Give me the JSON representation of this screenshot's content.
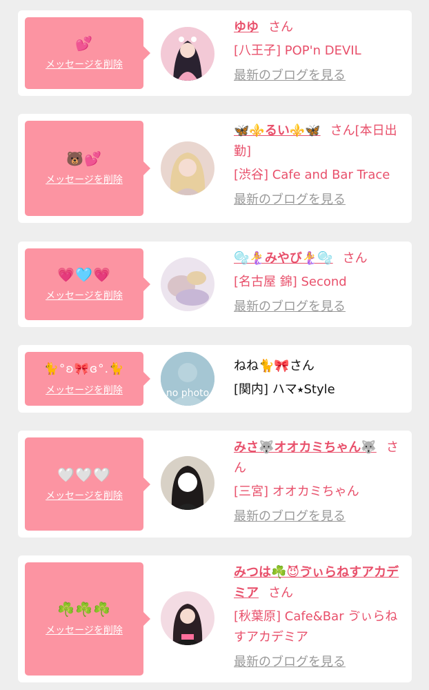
{
  "colors": {
    "accent": "#e8506b",
    "bubble": "#fc94a2",
    "link_gray": "#999999"
  },
  "delete_label": "メッセージを削除",
  "blog_label": "最新のブログを見る",
  "items": [
    {
      "emoji": "💕",
      "name": "ゆゆ",
      "suffix": "さん",
      "shop": "[八王子] POP'n DEVIL"
    },
    {
      "emoji": "🐻💕",
      "name": "🦋⚜️るい⚜️🦋",
      "suffix": "さん[本日出勤]",
      "shop": "[渋谷] Cafe and Bar Trace"
    },
    {
      "emoji": "💗🩵💗",
      "name": "🫧🧜‍♀️みやび🧜‍♀️🫧",
      "suffix": "さん",
      "shop": "[名古屋 錦] Second"
    },
    {
      "emoji": "🐈°ʚ🎀ɞ°.🐈",
      "name": "ねね🐈🎀",
      "suffix": "さん",
      "shop": "[関内] ハマ⭑Style",
      "avatar_text": "no photo"
    },
    {
      "emoji": "🤍🤍🤍",
      "name": "みさ🐺オオカミちゃん🐺",
      "suffix": "さん",
      "shop": "[三宮] オオカミちゃん"
    },
    {
      "emoji": "☘️☘️☘️",
      "name": "みつは☘️😈ゔぃらねすアカデミア",
      "suffix": "さん",
      "shop": "[秋葉原] Cafe&Bar ゔぃらねすアカデミア"
    }
  ]
}
